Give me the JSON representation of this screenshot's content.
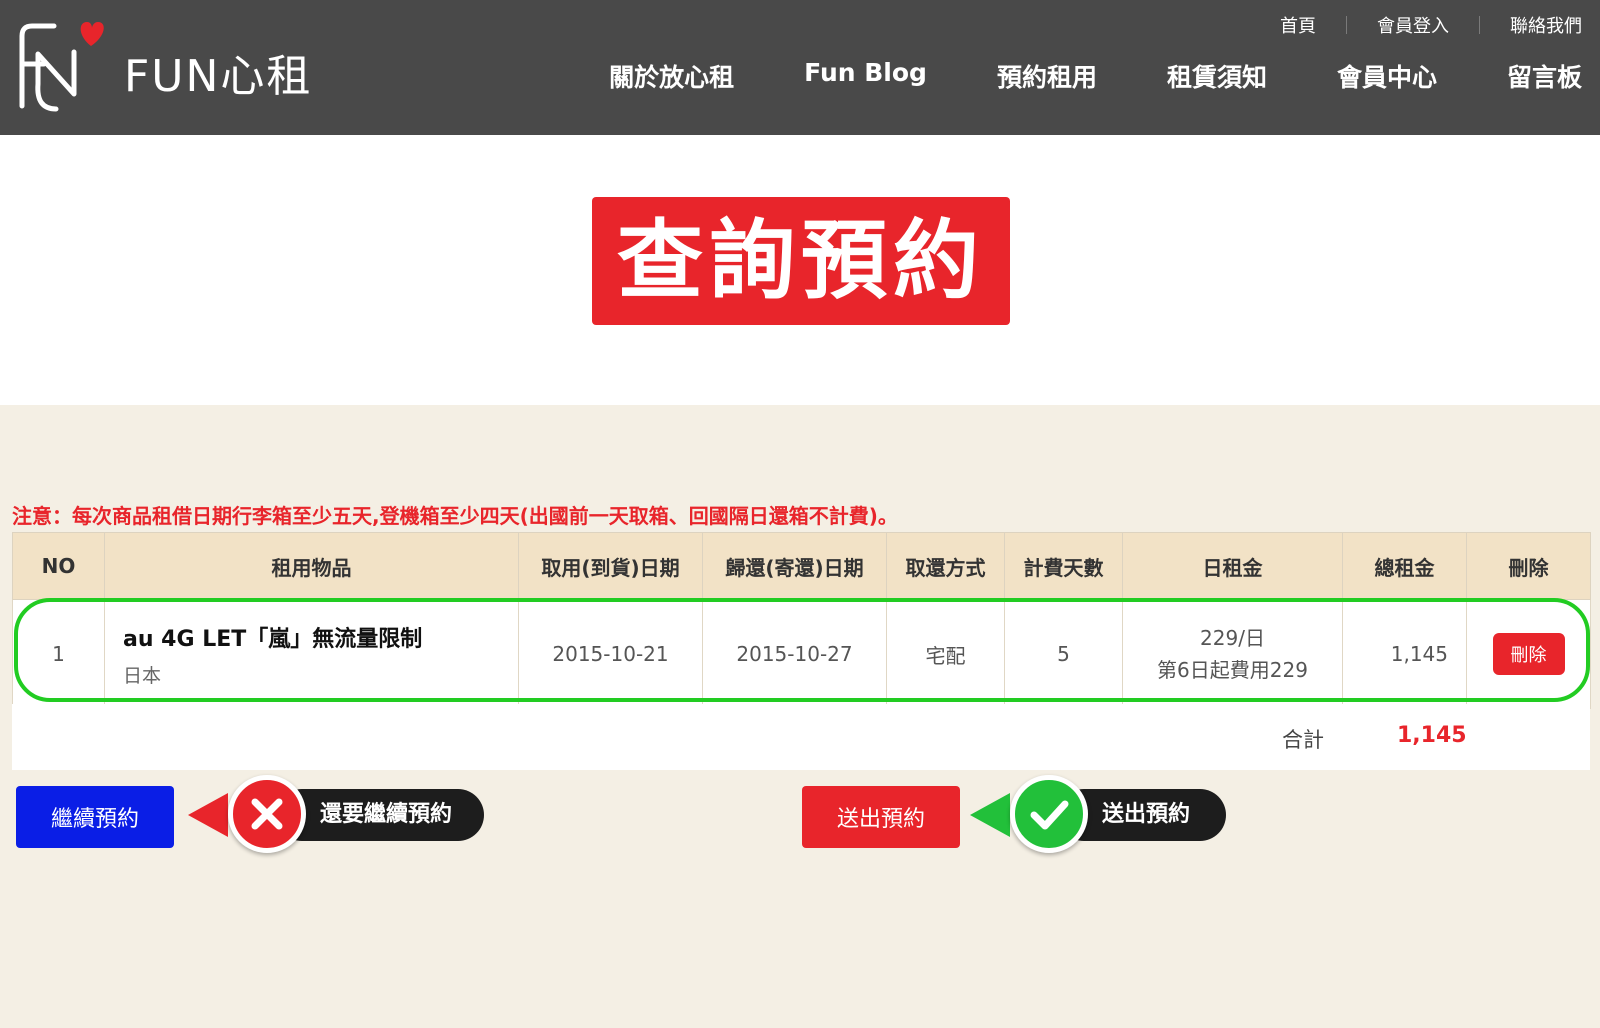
{
  "header": {
    "logo_text": "FUN心租",
    "top_links": [
      "首頁",
      "會員登入",
      "聯絡我們"
    ],
    "nav": [
      "關於放心租",
      "Fun Blog",
      "預約租用",
      "租賃須知",
      "會員中心",
      "留言板"
    ]
  },
  "page": {
    "title": "查詢預約",
    "notice": "注意：每次商品租借日期行李箱至少五天,登機箱至少四天(出國前一天取箱、回國隔日還箱不計費)。"
  },
  "table": {
    "headers": [
      "NO",
      "租用物品",
      "取用(到貨)日期",
      "歸還(寄還)日期",
      "取還方式",
      "計費天數",
      "日租金",
      "總租金",
      "刪除"
    ],
    "rows": [
      {
        "no": "1",
        "item_name": "au 4G LET「嵐」無流量限制",
        "item_region": "日本",
        "pickup_date": "2015-10-21",
        "return_date": "2015-10-27",
        "method": "宅配",
        "days": "5",
        "rate_line1": "229/日",
        "rate_line2": "第6日起費用229",
        "total": "1,145",
        "delete_label": "刪除"
      }
    ],
    "sum_label": "合計",
    "sum_value": "1,145"
  },
  "actions": {
    "continue_label": "繼續預約",
    "continue_callout": "還要繼續預約",
    "submit_label": "送出預約",
    "submit_callout": "送出預約"
  },
  "colors": {
    "accent_red": "#e8252b",
    "header_bg": "#494949",
    "continue_blue": "#0a1ee6",
    "highlight_green": "#22cc22"
  }
}
